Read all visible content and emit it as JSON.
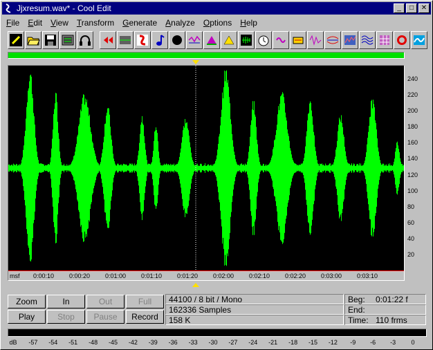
{
  "window": {
    "title": "Jjxresum.wav* - Cool Edit",
    "minimize": "_",
    "maximize": "□",
    "close": "✕"
  },
  "menu": [
    {
      "key": "F",
      "rest": "ile"
    },
    {
      "key": "E",
      "rest": "dit"
    },
    {
      "key": "V",
      "rest": "iew"
    },
    {
      "key": "T",
      "rest": "ransform"
    },
    {
      "key": "G",
      "rest": "enerate"
    },
    {
      "key": "A",
      "rest": "nalyze"
    },
    {
      "key": "O",
      "rest": "ptions"
    },
    {
      "key": "H",
      "rest": "elp"
    }
  ],
  "toolbar": {
    "group1": [
      "new-icon",
      "open-icon",
      "save-icon",
      "cd-icon",
      "headphones-icon"
    ],
    "group2": [
      "reverse-icon",
      "silence-icon",
      "invert-icon",
      "pitch-icon",
      "noise-icon",
      "delay-icon",
      "filter-icon",
      "amplify-icon",
      "envelope-icon",
      "timer-icon",
      "flanger-icon",
      "chorus-icon",
      "echo-icon",
      "distortion-icon",
      "spectrum-icon",
      "brainwave-icon",
      "grid-icon",
      "dynamics-icon",
      "wave-icon"
    ]
  },
  "time_ruler": {
    "unit": "msf",
    "labels": [
      "0:00:10",
      "0:00:20",
      "0:01:00",
      "0:01:10",
      "0:01:20",
      "0:02:00",
      "0:02:10",
      "0:02:20",
      "0:03:00",
      "0:03:10"
    ]
  },
  "amp_ruler": {
    "labels": [
      "240",
      "220",
      "200",
      "180",
      "160",
      "140",
      "120",
      "100",
      "80",
      "60",
      "40",
      "20"
    ]
  },
  "waveform": {
    "color": "#00ff00",
    "background": "#000000",
    "cursor_time": "0:01:22"
  },
  "transport": {
    "zoom": "Zoom",
    "in": "In",
    "out": "Out",
    "full": "Full",
    "play": "Play",
    "stop": "Stop",
    "pause": "Pause",
    "record": "Record"
  },
  "info": {
    "format": "44100 / 8 bit / Mono",
    "samples": "162336 Samples",
    "size": "158 K"
  },
  "selection": {
    "beg_label": "Beg:",
    "beg_value": "0:01:22 f",
    "end_label": "End:",
    "end_value": "",
    "time_label": "Time:",
    "time_value": "110 frms"
  },
  "meter": {
    "labels": [
      "dB",
      "-57",
      "-54",
      "-51",
      "-48",
      "-45",
      "-42",
      "-39",
      "-36",
      "-33",
      "-30",
      "-27",
      "-24",
      "-21",
      "-18",
      "-15",
      "-12",
      "-9",
      "-6",
      "-3",
      "0"
    ]
  }
}
